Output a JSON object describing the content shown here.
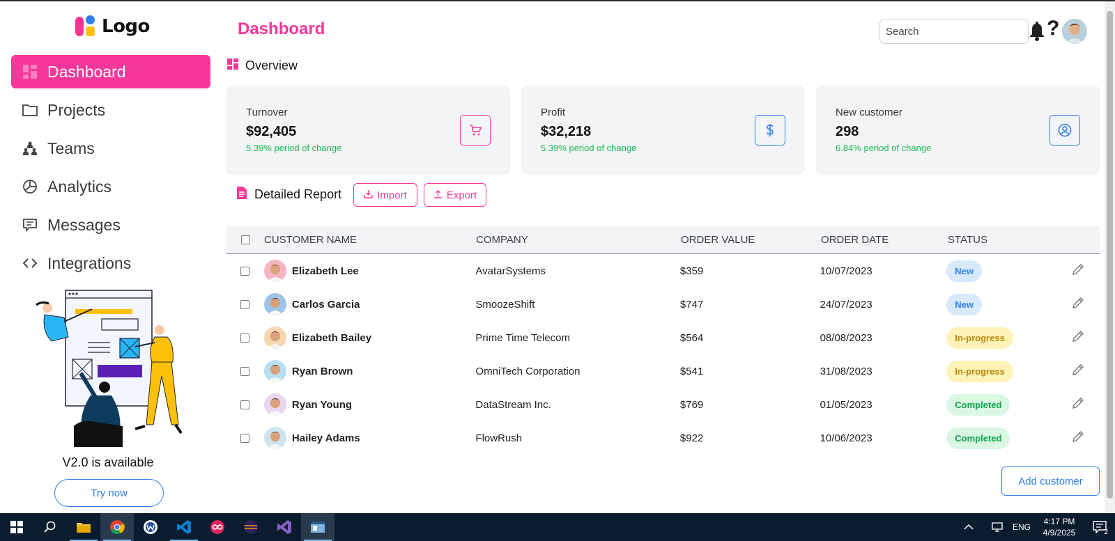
{
  "logo": {
    "text": "Logo"
  },
  "sidebar": {
    "items": [
      {
        "label": "Dashboard",
        "icon": "dashboard-icon",
        "active": true
      },
      {
        "label": "Projects",
        "icon": "folder-icon"
      },
      {
        "label": "Teams",
        "icon": "teams-icon"
      },
      {
        "label": "Analytics",
        "icon": "pie-chart-icon"
      },
      {
        "label": "Messages",
        "icon": "message-icon"
      },
      {
        "label": "Integrations",
        "icon": "code-icon"
      }
    ],
    "promo": {
      "text": "V2.0 is available",
      "button": "Try now"
    }
  },
  "header": {
    "title": "Dashboard",
    "search_placeholder": "Search",
    "help_glyph": "?"
  },
  "overview": {
    "heading": "Overview",
    "cards": [
      {
        "title": "Turnover",
        "value": "$92,405",
        "change": "5.39% period of change",
        "icon": "cart-icon",
        "accent": "#f7379a"
      },
      {
        "title": "Profit",
        "value": "$32,218",
        "change": "5.39% period of change",
        "icon": "dollar-icon",
        "accent": "#2f80ed"
      },
      {
        "title": "New customer",
        "value": "298",
        "change": "6.84% period of change",
        "icon": "user-circle-icon",
        "accent": "#2f80ed"
      }
    ]
  },
  "report": {
    "heading": "Detailed Report",
    "import_label": "Import",
    "export_label": "Export",
    "columns": [
      "CUSTOMER NAME",
      "COMPANY",
      "ORDER VALUE",
      "ORDER DATE",
      "STATUS"
    ],
    "rows": [
      {
        "name": "Elizabeth Lee",
        "company": "AvatarSystems",
        "value": "$359",
        "date": "10/07/2023",
        "status": "New",
        "status_kind": "new"
      },
      {
        "name": "Carlos Garcia",
        "company": "SmoozeShift",
        "value": "$747",
        "date": "24/07/2023",
        "status": "New",
        "status_kind": "new"
      },
      {
        "name": "Elizabeth Bailey",
        "company": "Prime Time Telecom",
        "value": "$564",
        "date": "08/08/2023",
        "status": "In-progress",
        "status_kind": "progress"
      },
      {
        "name": "Ryan Brown",
        "company": "OmniTech Corporation",
        "value": "$541",
        "date": "31/08/2023",
        "status": "In-progress",
        "status_kind": "progress"
      },
      {
        "name": "Ryan Young",
        "company": "DataStream Inc.",
        "value": "$769",
        "date": "01/05/2023",
        "status": "Completed",
        "status_kind": "done"
      },
      {
        "name": "Hailey Adams",
        "company": "FlowRush",
        "value": "$922",
        "date": "10/06/2023",
        "status": "Completed",
        "status_kind": "done"
      }
    ],
    "add_button": "Add customer"
  },
  "taskbar": {
    "apps": [
      "windows-start-icon",
      "search-icon",
      "file-explorer-icon",
      "chrome-icon",
      "app-w-icon",
      "vscode-icon",
      "app-oo-icon",
      "eclipse-icon",
      "visual-studio-icon",
      "app-window-icon"
    ],
    "language": "ENG",
    "time": "4:17 PM",
    "date": "4/9/2025",
    "notification_count": "2"
  },
  "colors": {
    "accent": "#f7379a",
    "blue": "#2f80ed",
    "green": "#1db954"
  }
}
